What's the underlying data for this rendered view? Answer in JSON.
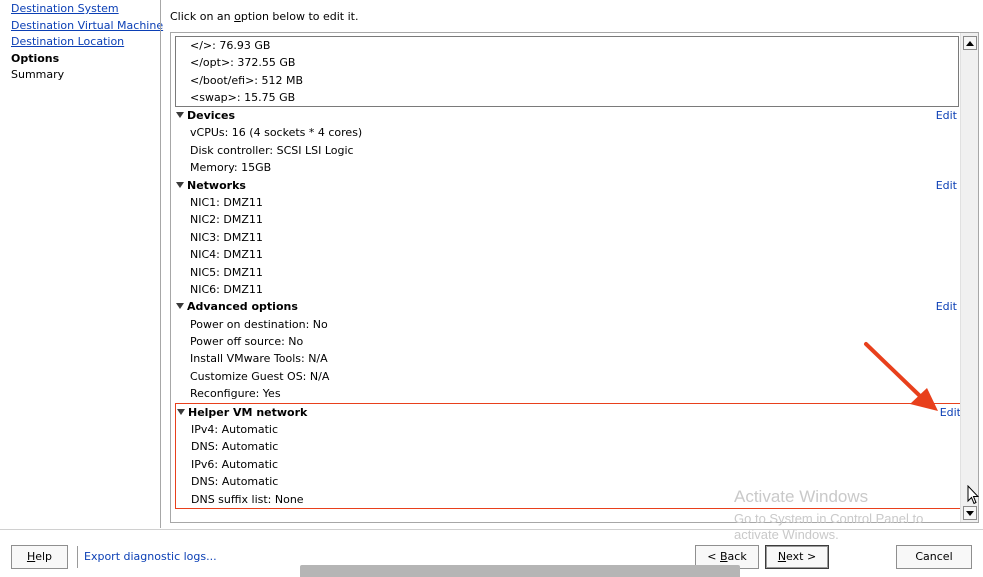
{
  "nav": {
    "items": [
      {
        "label": "Destination System",
        "state": "link"
      },
      {
        "label": "Destination Virtual Machine",
        "state": "link"
      },
      {
        "label": "Destination Location",
        "state": "link"
      },
      {
        "label": "Options",
        "state": "current"
      },
      {
        "label": "Summary",
        "state": "plain"
      }
    ]
  },
  "instruction": {
    "before": "Click on an ",
    "accel": "o",
    "after": "ption below to edit it."
  },
  "disk_list": [
    "</>: 76.93 GB",
    "</opt>: 372.55 GB",
    "</boot/efi>: 512 MB",
    "<swap>: 15.75 GB"
  ],
  "sections": [
    {
      "title": "Devices",
      "edit_label": "Edit",
      "lines": [
        "vCPUs: 16 (4 sockets * 4 cores)",
        "Disk controller: SCSI LSI Logic",
        "Memory: 15GB"
      ]
    },
    {
      "title": "Networks",
      "edit_label": "Edit",
      "lines": [
        "NIC1: DMZ11",
        "NIC2: DMZ11",
        "NIC3: DMZ11",
        "NIC4: DMZ11",
        "NIC5: DMZ11",
        "NIC6: DMZ11"
      ]
    },
    {
      "title": "Advanced options",
      "edit_label": "Edit",
      "lines": [
        "Power on destination: No",
        "Power off source: No",
        "Install VMware Tools: N/A",
        "Customize Guest OS: N/A",
        "Reconfigure: Yes"
      ]
    },
    {
      "title": "Helper VM network",
      "edit_label": "Edit",
      "lines": [
        "IPv4: Automatic",
        "DNS: Automatic",
        "IPv6: Automatic",
        "DNS: Automatic",
        "DNS suffix list: None"
      ]
    }
  ],
  "watermark": {
    "line1": "Activate Windows",
    "line2": "Go to System in Control Panel to",
    "line3": "activate Windows."
  },
  "footer": {
    "help": {
      "accel": "H",
      "rest": "elp"
    },
    "export_label": "Export diagnostic logs...",
    "back": {
      "prefix": "< ",
      "accel": "B",
      "rest": "ack"
    },
    "next": {
      "accel": "N",
      "rest": "ext >"
    },
    "cancel_label": "Cancel"
  },
  "colors": {
    "link": "#0b3fb5",
    "highlight_border": "#e8401c",
    "annotation_arrow": "#e8401c",
    "watermark": "#c9c9c9"
  }
}
